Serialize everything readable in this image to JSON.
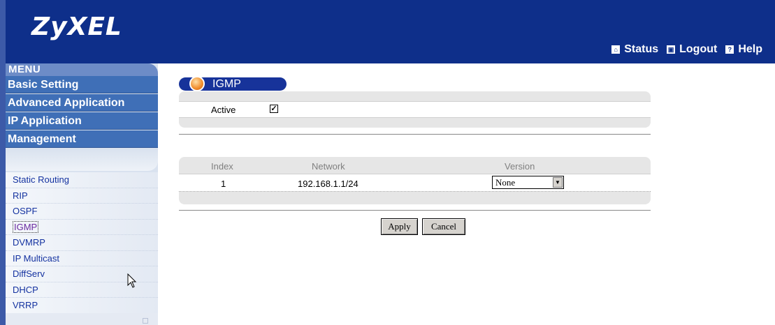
{
  "header": {
    "logo": "ZyXEL",
    "links": [
      {
        "label": "Status",
        "icon": "home-icon"
      },
      {
        "label": "Logout",
        "icon": "logout-icon"
      },
      {
        "label": "Help",
        "icon": "help-icon"
      }
    ]
  },
  "sidebar": {
    "menu_label": "MENU",
    "menu_items": [
      "Basic Setting",
      "Advanced Application",
      "IP Application",
      "Management"
    ],
    "sub_items": [
      "Static Routing",
      "RIP",
      "OSPF",
      "IGMP",
      "DVMRP",
      "IP Multicast",
      "DiffServ",
      "DHCP",
      "VRRP"
    ],
    "active_sub_item": "IGMP"
  },
  "main": {
    "title": "IGMP",
    "active_label": "Active",
    "active_checked": true,
    "table": {
      "headers": [
        "Index",
        "Network",
        "Version"
      ],
      "rows": [
        {
          "index": "1",
          "network": "192.168.1.1/24",
          "version": "None"
        }
      ]
    },
    "buttons": {
      "apply": "Apply",
      "cancel": "Cancel"
    }
  },
  "colors": {
    "header_bg": "#0e2f8a",
    "menu_bg": "#3f6fb7",
    "link_color": "#1432a0"
  }
}
